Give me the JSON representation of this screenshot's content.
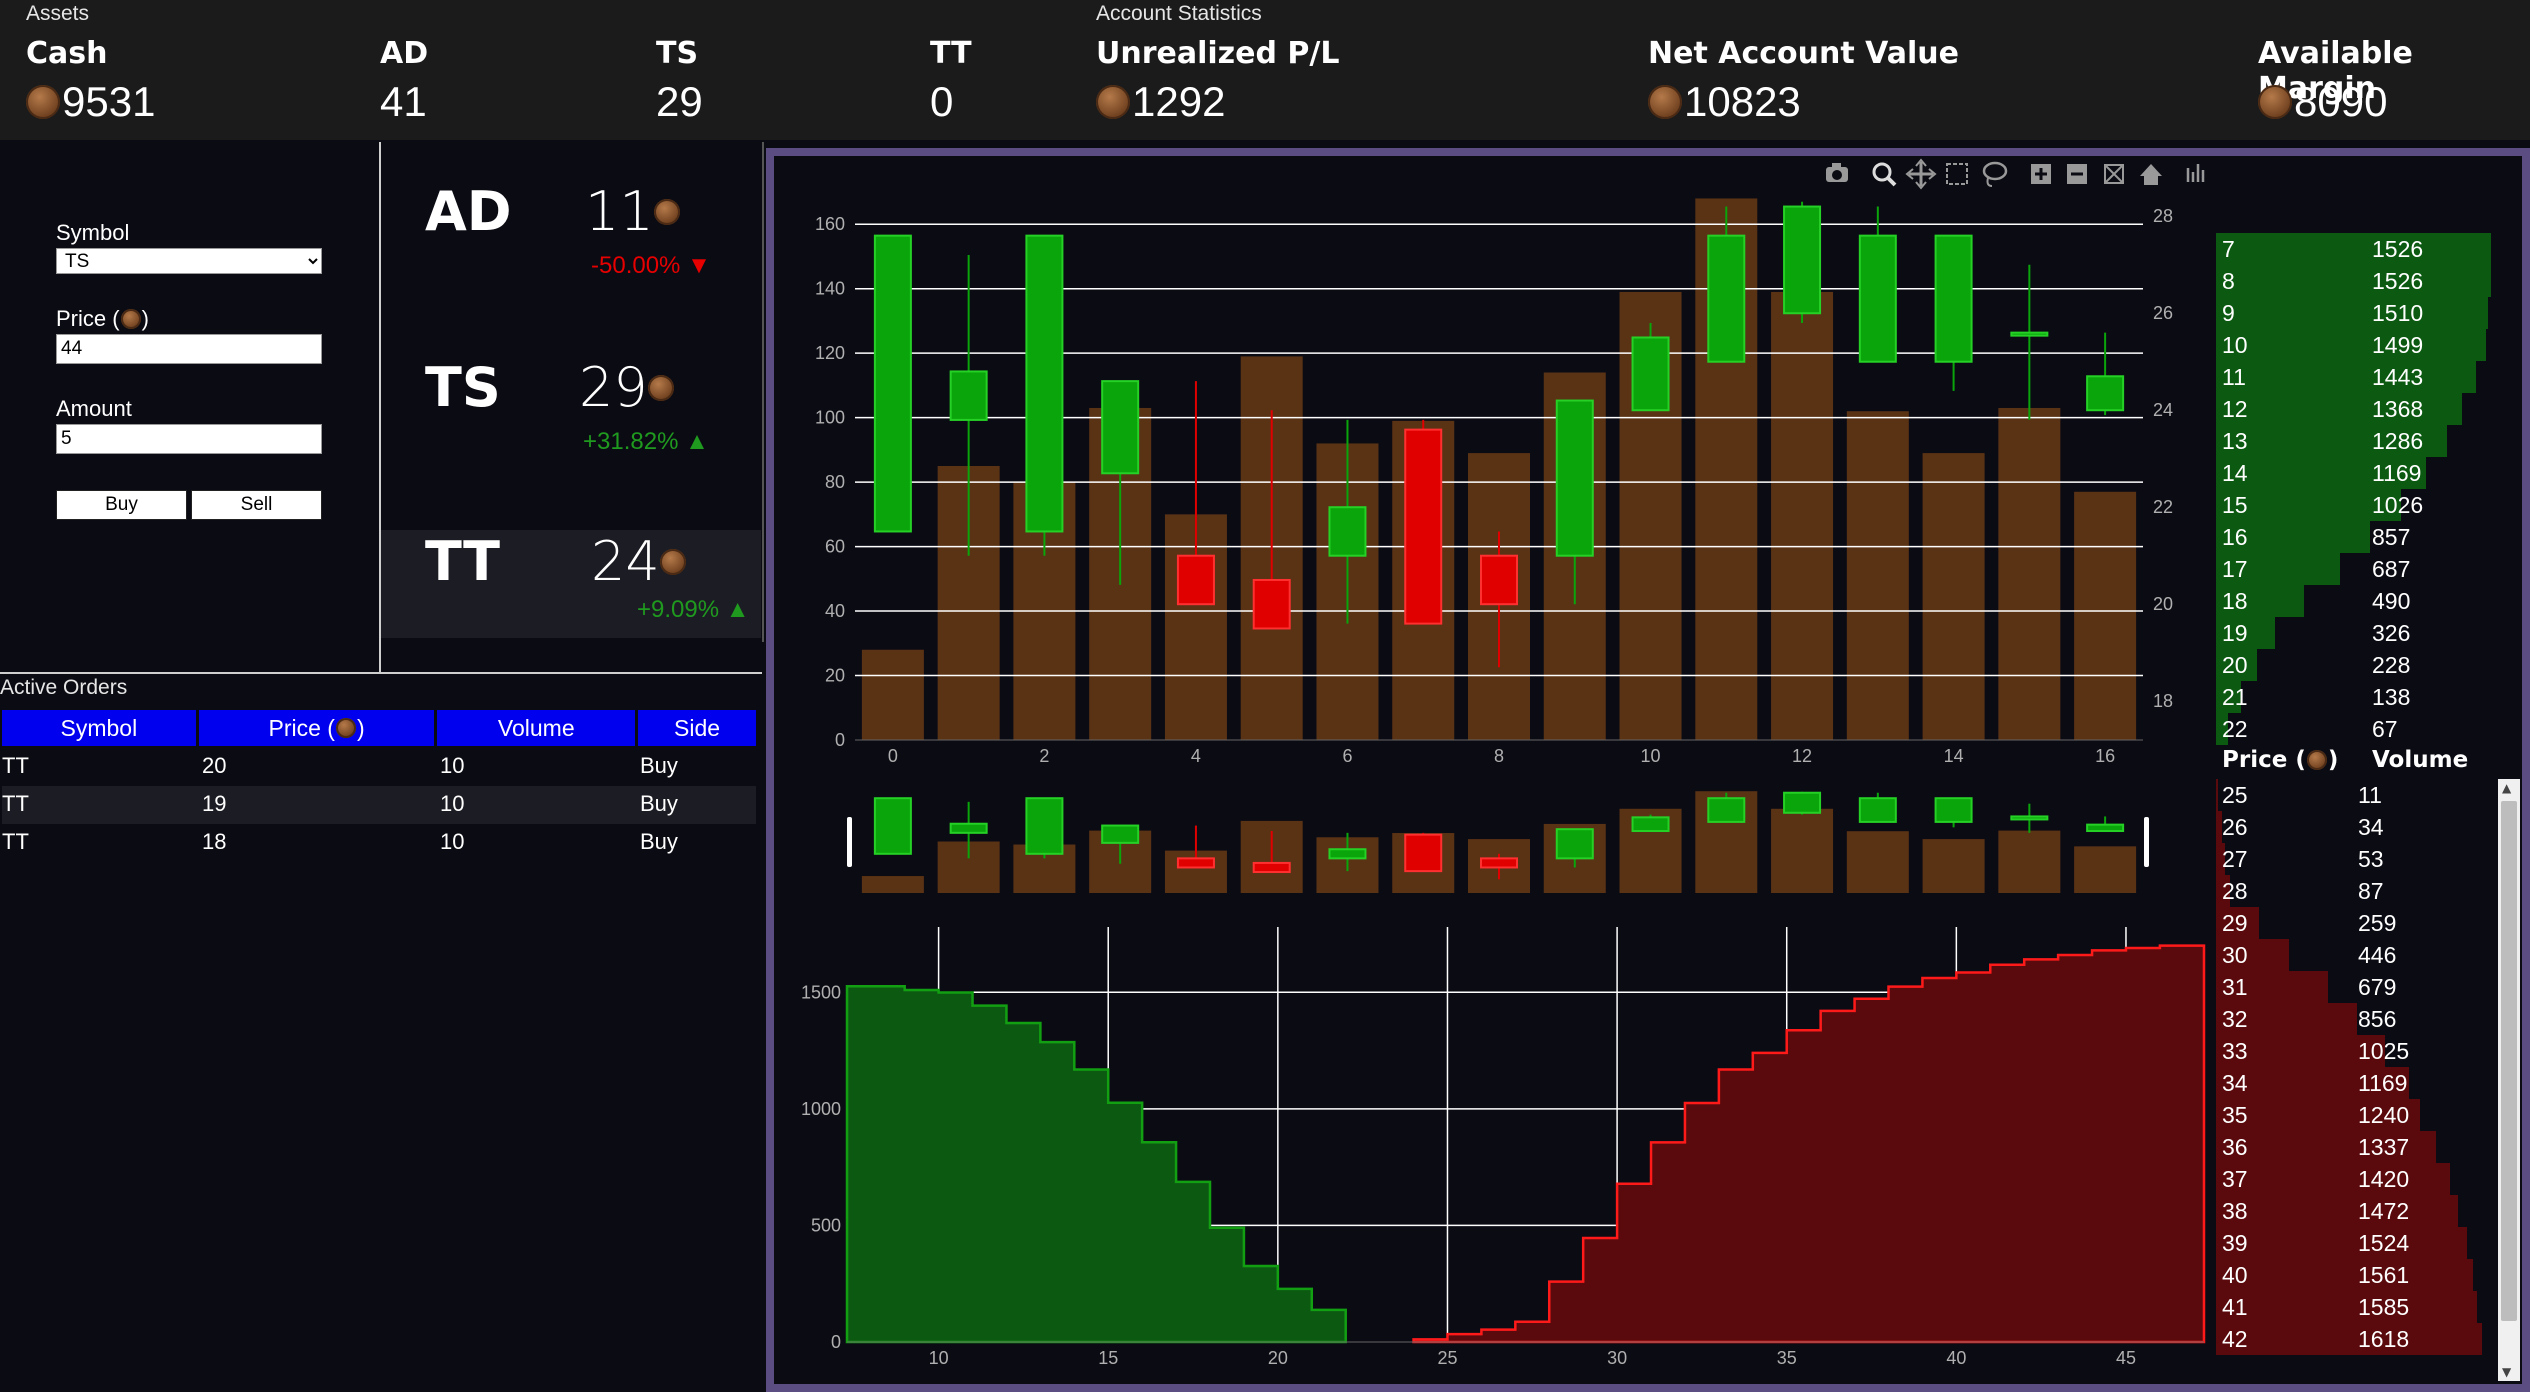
{
  "assets": {
    "caption": "Assets",
    "cash": {
      "label": "Cash",
      "value": "9531"
    },
    "ad": {
      "label": "AD",
      "value": "41"
    },
    "ts": {
      "label": "TS",
      "value": "29"
    },
    "tt": {
      "label": "TT",
      "value": "0"
    }
  },
  "account": {
    "caption": "Account Statistics",
    "unrealized": {
      "label": "Unrealized P/L",
      "value": "1292"
    },
    "net_value": {
      "label": "Net Account Value",
      "value": "10823"
    },
    "available_margin": {
      "label": "Available Margin",
      "value": "8090"
    }
  },
  "trade_form": {
    "symbol_label": "Symbol",
    "symbol_value": "TS",
    "price_label": "Price (",
    "price_label_end": ")",
    "price_value": "44",
    "amount_label": "Amount",
    "amount_value": "5",
    "buy_label": "Buy",
    "sell_label": "Sell"
  },
  "tickers": [
    {
      "symbol": "AD",
      "price": "11",
      "change": "-50.00%",
      "direction": "down"
    },
    {
      "symbol": "TS",
      "price": "29",
      "change": "+31.82%",
      "direction": "up"
    },
    {
      "symbol": "TT",
      "price": "24",
      "change": "+9.09%",
      "direction": "up"
    }
  ],
  "orders": {
    "caption": "Active Orders",
    "headers": {
      "symbol": "Symbol",
      "price": "Price (",
      "price_end": ")",
      "volume": "Volume",
      "side": "Side"
    },
    "rows": [
      {
        "symbol": "TT",
        "price": "20",
        "volume": "10",
        "side": "Buy"
      },
      {
        "symbol": "TT",
        "price": "19",
        "volume": "10",
        "side": "Buy"
      },
      {
        "symbol": "TT",
        "price": "18",
        "volume": "10",
        "side": "Buy"
      }
    ]
  },
  "colors": {
    "green_candle": "#0aa50a",
    "red_candle": "#e00000",
    "volume_bar": "#5a3214",
    "bid_fill": "#0c5a12",
    "ask_fill": "#5a0a0c",
    "header_blue": "#0000ee",
    "frame": "#5b4d82"
  },
  "modebar_icons": [
    "camera-icon",
    "zoom-icon",
    "pan-icon",
    "box-select-icon",
    "lasso-icon",
    "zoom-in-icon",
    "zoom-out-icon",
    "autoscale-icon",
    "reset-icon",
    "spikelines-icon"
  ],
  "chart_data": [
    {
      "type": "candlestick",
      "x": [
        0,
        1,
        2,
        3,
        4,
        5,
        6,
        7,
        8,
        9,
        10,
        11,
        12,
        13,
        14,
        15,
        16
      ],
      "open": [
        21.5,
        23.8,
        21.5,
        22.7,
        21.0,
        20.5,
        21.0,
        23.6,
        21.0,
        21.0,
        24.0,
        25.0,
        26.0,
        25.0,
        25.0,
        25.6,
        24.0
      ],
      "high": [
        27.6,
        27.2,
        27.6,
        24.6,
        24.6,
        24.0,
        23.8,
        23.8,
        21.5,
        24.2,
        25.8,
        28.2,
        28.3,
        28.2,
        27.6,
        27.0,
        25.6
      ],
      "low": [
        21.5,
        21.0,
        21.0,
        20.4,
        20.0,
        19.5,
        19.6,
        19.6,
        18.7,
        20.0,
        24.0,
        25.8,
        25.8,
        25.0,
        24.4,
        23.8,
        23.9
      ],
      "close": [
        27.6,
        24.8,
        27.6,
        24.6,
        20.0,
        19.5,
        22.0,
        19.6,
        20.0,
        24.2,
        25.5,
        27.6,
        28.2,
        27.6,
        27.6,
        25.6,
        24.7
      ],
      "y2_range": [
        17.2,
        28.5
      ],
      "y2_ticks": [
        18,
        20,
        22,
        24,
        26,
        28
      ]
    },
    {
      "type": "bar",
      "name": "",
      "x": [
        0,
        1,
        2,
        3,
        4,
        5,
        6,
        7,
        8,
        9,
        10,
        11,
        12,
        13,
        14,
        15,
        16
      ],
      "values": [
        28,
        85,
        80,
        103,
        70,
        119,
        92,
        99,
        89,
        114,
        139,
        168,
        139,
        102,
        89,
        103,
        77
      ],
      "ylim": [
        0,
        170
      ],
      "y_ticks": [
        0,
        20,
        40,
        60,
        80,
        100,
        120,
        140,
        160
      ],
      "x_ticks": [
        0,
        2,
        4,
        6,
        8,
        10,
        12,
        14,
        16
      ]
    },
    {
      "type": "area",
      "subtype": "depth",
      "bids": {
        "x": [
          8,
          9,
          10,
          11,
          12,
          13,
          14,
          15,
          16,
          17,
          18,
          19,
          20,
          21,
          22
        ],
        "y": [
          1526,
          1526,
          1510,
          1499,
          1443,
          1368,
          1286,
          1169,
          1026,
          857,
          687,
          490,
          326,
          228,
          138
        ]
      },
      "asks": {
        "x": [
          25,
          26,
          27,
          28,
          29,
          30,
          31,
          32,
          33,
          34,
          35,
          36,
          37,
          38,
          39,
          40,
          41,
          42,
          43,
          44,
          45,
          46,
          47
        ],
        "y": [
          11,
          34,
          53,
          87,
          259,
          446,
          679,
          856,
          1025,
          1169,
          1240,
          1337,
          1420,
          1472,
          1524,
          1561,
          1585,
          1618,
          1641,
          1660,
          1680,
          1690,
          1700
        ]
      },
      "x_ticks": [
        10,
        15,
        20,
        25,
        30,
        35,
        40,
        45
      ],
      "y_ticks": [
        0,
        500,
        1000,
        1500
      ],
      "xlim": [
        7.3,
        47.3
      ],
      "ylim": [
        0,
        1780
      ]
    }
  ],
  "order_book": {
    "bids": [
      {
        "price": "7",
        "volume": "1526"
      },
      {
        "price": "8",
        "volume": "1526"
      },
      {
        "price": "9",
        "volume": "1510"
      },
      {
        "price": "10",
        "volume": "1499"
      },
      {
        "price": "11",
        "volume": "1443"
      },
      {
        "price": "12",
        "volume": "1368"
      },
      {
        "price": "13",
        "volume": "1286"
      },
      {
        "price": "14",
        "volume": "1169"
      },
      {
        "price": "15",
        "volume": "1026"
      },
      {
        "price": "16",
        "volume": "857"
      },
      {
        "price": "17",
        "volume": "687"
      },
      {
        "price": "18",
        "volume": "490"
      },
      {
        "price": "19",
        "volume": "326"
      },
      {
        "price": "20",
        "volume": "228"
      },
      {
        "price": "21",
        "volume": "138"
      },
      {
        "price": "22",
        "volume": "67"
      }
    ],
    "header": {
      "price": "Price (",
      "price_end": ")",
      "volume": "Volume"
    },
    "asks": [
      {
        "price": "25",
        "volume": "11"
      },
      {
        "price": "26",
        "volume": "34"
      },
      {
        "price": "27",
        "volume": "53"
      },
      {
        "price": "28",
        "volume": "87"
      },
      {
        "price": "29",
        "volume": "259"
      },
      {
        "price": "30",
        "volume": "446"
      },
      {
        "price": "31",
        "volume": "679"
      },
      {
        "price": "32",
        "volume": "856"
      },
      {
        "price": "33",
        "volume": "1025"
      },
      {
        "price": "34",
        "volume": "1169"
      },
      {
        "price": "35",
        "volume": "1240"
      },
      {
        "price": "36",
        "volume": "1337"
      },
      {
        "price": "37",
        "volume": "1420"
      },
      {
        "price": "38",
        "volume": "1472"
      },
      {
        "price": "39",
        "volume": "1524"
      },
      {
        "price": "40",
        "volume": "1561"
      },
      {
        "price": "41",
        "volume": "1585"
      },
      {
        "price": "42",
        "volume": "1618"
      }
    ]
  }
}
